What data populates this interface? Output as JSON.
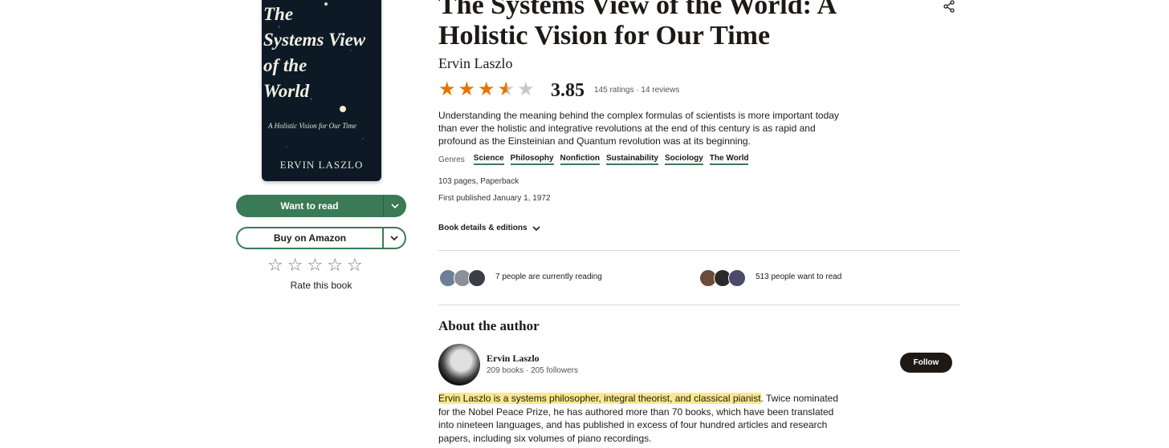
{
  "cover": {
    "title_line1": "The",
    "title_line2": "Systems View",
    "title_line3": "of the",
    "title_line4": "World",
    "subtitle": "A Holistic Vision for Our Time",
    "author": "ERVIN LASZLO"
  },
  "actions": {
    "want_to_read": "Want to read",
    "buy": "Buy on Amazon",
    "rate_label": "Rate this book"
  },
  "book": {
    "title": "The Systems View of the World: A Holistic Vision for Our Time",
    "author": "Ervin Laszlo",
    "average_rating": "3.85",
    "rating_value": 3.85,
    "ratings_count": "145 ratings",
    "separator": "·",
    "reviews_count": "14 reviews",
    "description": "Understanding the meaning behind the complex formulas of scientists is more important today than ever the holistic and integrative revolutions at the end of this century is as rapid and profound as the Einsteinian and Quantum revolution was at its beginning.",
    "genres_label": "Genres",
    "genres": [
      "Science",
      "Philosophy",
      "Nonfiction",
      "Sustainability",
      "Sociology",
      "The World"
    ],
    "pages_format": "103 pages, Paperback",
    "published": "First published January 1, 1972",
    "details_link": "Book details & editions"
  },
  "social": {
    "currently_reading": "7 people are currently reading",
    "want_to_read": "513 people want to read"
  },
  "about": {
    "heading": "About the author",
    "name": "Ervin Laszlo",
    "books": "209 books",
    "separator": "·",
    "followers": "205 followers",
    "follow_label": "Follow",
    "bio_highlight": "Ervin Laszlo is a systems philosopher, integral theorist, and classical pianist",
    "bio_rest": ". Twice nominated for the Nobel Peace Prize, he has authored more than 70 books, which have been translated into nineteen languages, and has published in excess of four hundred articles and research papers, including six volumes of piano recordings."
  },
  "colors": {
    "brand_green": "#3a7a57",
    "star_orange": "#e87400",
    "highlight": "#fbe88a"
  },
  "icons": [
    "share-icon",
    "chevron-down-icon",
    "star-icon"
  ]
}
